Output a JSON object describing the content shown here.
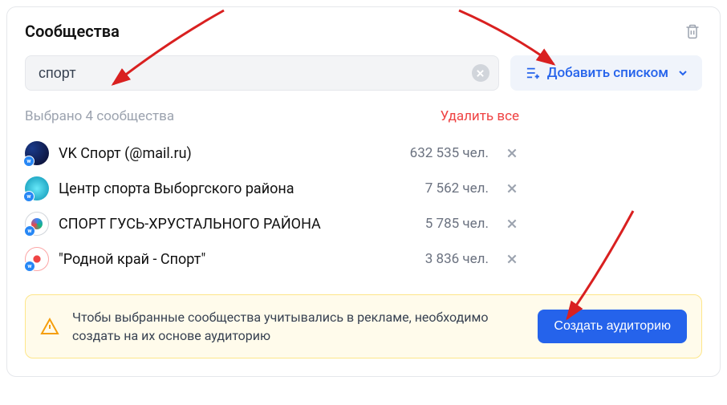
{
  "panel": {
    "title": "Сообщества"
  },
  "search": {
    "value": "спорт",
    "placeholder": ""
  },
  "addList": {
    "label": "Добавить списком"
  },
  "selection": {
    "countLabel": "Выбрано 4 сообщества",
    "removeAllLabel": "Удалить все"
  },
  "items": [
    {
      "name": "VK Спорт (@mail.ru)",
      "count": "632 535 чел."
    },
    {
      "name": "Центр спорта Выборгского района",
      "count": "7 562 чел."
    },
    {
      "name": "СПОРТ ГУСЬ-ХРУСТАЛЬНОГО РАЙОНА",
      "count": "5 785 чел."
    },
    {
      "name": "\"Родной край - Спорт\"",
      "count": "3 836 чел."
    }
  ],
  "notice": {
    "text": "Чтобы выбранные сообщества учитывались в рекламе, необходимо создать на их основе аудиторию",
    "buttonLabel": "Создать аудиторию"
  }
}
